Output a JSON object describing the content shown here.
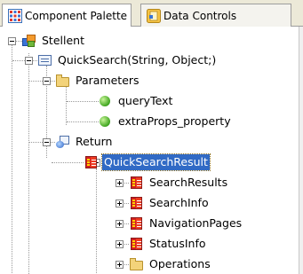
{
  "tabs": [
    {
      "label": "Component Palette",
      "icon": "component-palette-icon",
      "active": true
    },
    {
      "label": "Data Controls",
      "icon": "data-controls-icon",
      "active": false
    }
  ],
  "tree": {
    "root": {
      "label": "Stellent",
      "icon": "application-icon",
      "expanded": true
    },
    "method": {
      "label": "QuickSearch(String, Object;)",
      "icon": "method-icon",
      "expanded": true
    },
    "parameters": {
      "label": "Parameters",
      "icon": "folder-icon",
      "expanded": true
    },
    "param_items": [
      {
        "label": "queryText",
        "icon": "parameter-icon"
      },
      {
        "label": "extraProps_property",
        "icon": "parameter-icon"
      }
    ],
    "return": {
      "label": "Return",
      "icon": "return-icon",
      "expanded": true
    },
    "result": {
      "label": "QuickSearchResult",
      "icon": "struct-icon",
      "expanded": true,
      "selected": true
    },
    "result_children": [
      {
        "label": "SearchResults",
        "icon": "struct-icon",
        "expanded": false
      },
      {
        "label": "SearchInfo",
        "icon": "struct-icon",
        "expanded": false
      },
      {
        "label": "NavigationPages",
        "icon": "struct-icon",
        "expanded": false
      },
      {
        "label": "StatusInfo",
        "icon": "struct-icon",
        "expanded": false
      },
      {
        "label": "Operations",
        "icon": "folder-icon",
        "expanded": false
      }
    ]
  },
  "colors": {
    "selection": "#316ac5",
    "tab_background": "#ece9d8",
    "tree_lines": "#9a9a9a"
  }
}
